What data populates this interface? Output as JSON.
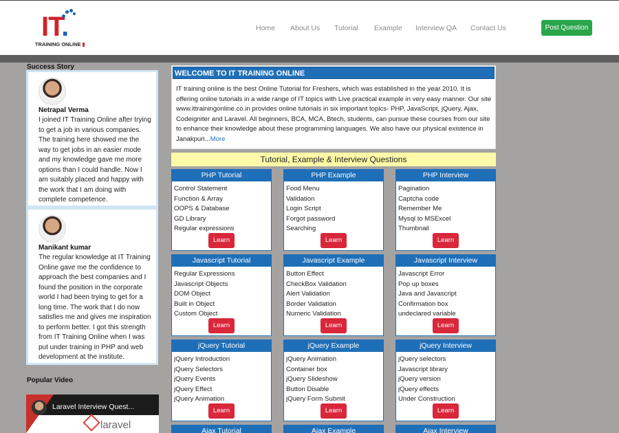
{
  "brand": {
    "logo_main": "IT",
    "logo_dot": ".",
    "logo_sub": "TRAINING ONLINE"
  },
  "nav": {
    "items": [
      "Home",
      "About Us",
      "Tutorial",
      "Example",
      "Interview QA",
      "Contact Us"
    ],
    "post_label": "Post Question"
  },
  "sidebar": {
    "success_title": "Success Story",
    "stories": [
      {
        "name": "Netrapal Verma",
        "text": "I joined IT Training Online after trying to get a job in various companies. The training here showed me the way to get jobs in an easier mode and my knowledge gave me more options than I could handle. Now I am suitably placed and happy with the work that I am doing with complete competence."
      },
      {
        "name": "Manikant kumar",
        "text": "The regular knowledge at IT Training Online gave me the confidence to approach the best companies and I found the position in the corporate world I had been trying to get for a long time. The work that I do now satisfies me and gives me inspiration to perform better. I got this strength from IT Training Online when I was put under training in PHP and web development at the institute."
      }
    ],
    "video_title": "Popular Video",
    "video": {
      "caption": "Laravel Interview Quest...",
      "brand": "laravel"
    }
  },
  "welcome": {
    "title": "WELCOME TO IT TRAINING ONLINE",
    "body": "IT training online is the best Online Tutorial for Freshers, which was established in the year 2010. It is offering online tutorials in a wide range of IT topics with Live practical example in very easy manner. Our site www.ittrainingonline.co.in provides online tutorials in six important topics- PHP, JavaScript, jQuery, Ajax, Codeigniter and Laravel. All beginners, BCA, MCA, Btech, students, can pursue these courses from our site to enhance their knowledge about these programming languages. We also have our physical existence in Janakpuri...",
    "more": "More"
  },
  "section_title": "Tutorial, Example & Interview Questions",
  "learn_label": "Learn",
  "cards": [
    {
      "title": "PHP Tutorial",
      "items": [
        "Control Statement",
        "Function & Array",
        "OOPS & Database",
        "GD Library",
        "Regular expressions"
      ]
    },
    {
      "title": "PHP Example",
      "items": [
        "Food Menu",
        "Validation",
        "Login Script",
        "Forgot password",
        "Searching"
      ]
    },
    {
      "title": "PHP Interview",
      "items": [
        "Pagination",
        "Captcha code",
        "Remember Me",
        "Mysql to MSExcel",
        "Thumbnail"
      ]
    },
    {
      "title": "Javascript Tutorial",
      "items": [
        "Regular Expressions",
        "Javascript Objects",
        "DOM Object",
        "Built in Object",
        "Custom Object"
      ]
    },
    {
      "title": "Javascript Example",
      "items": [
        "Button Effect",
        "CheckBox Validation",
        "Alert Validation",
        "Border Validation",
        "Numeric Validation"
      ]
    },
    {
      "title": "Javascript Interview",
      "items": [
        "Javascript Error",
        "Pop up boxes",
        "Java and Javascript",
        "Confirmation box",
        "undeclared variable"
      ]
    },
    {
      "title": "jQuery Tutorial",
      "items": [
        "jQuery Introduction",
        "jQuery Selectors",
        "jQuery Events",
        "jQuery Effect",
        "jQuery Animation"
      ]
    },
    {
      "title": "jQuery Example",
      "items": [
        "jQuery Animation",
        "Container box",
        "jQuery Slideshow",
        "Button Disable",
        "jQuery Form Submit"
      ]
    },
    {
      "title": "jQuery Interview",
      "items": [
        "jQuery selectors",
        "Javascript library",
        "jQuery version",
        "jQuery effects",
        "Under Construction"
      ]
    },
    {
      "title": "Ajax Tutorial",
      "items": []
    },
    {
      "title": "Ajax Example",
      "items": []
    },
    {
      "title": "Ajax Interview",
      "items": []
    }
  ]
}
